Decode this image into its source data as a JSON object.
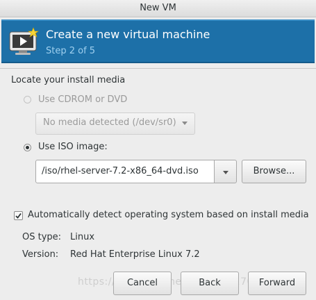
{
  "window": {
    "title": "New VM"
  },
  "banner": {
    "title": "Create a new virtual machine",
    "step": "Step 2 of 5",
    "icon": "vm-monitor-icon",
    "bg_color": "#1d70a8"
  },
  "media": {
    "section_label": "Locate your install media",
    "cdrom_label": "Use CDROM or DVD",
    "cdrom_selected": false,
    "cdrom_enabled": false,
    "cdrom_combo_value": "No media detected (/dev/sr0)",
    "iso_label": "Use ISO image:",
    "iso_selected": true,
    "iso_path": "/iso/rhel-server-7.2-x86_64-dvd.iso",
    "browse_label": "Browse..."
  },
  "detect": {
    "checked": true,
    "label": "Automatically detect operating system based on install media"
  },
  "os": {
    "type_label": "OS type:",
    "type_value": "Linux",
    "version_label": "Version:",
    "version_value": "Red Hat Enterprise Linux 7.2"
  },
  "footer": {
    "cancel_label": "Cancel",
    "back_label": "Back",
    "forward_label": "Forward"
  },
  "watermark": {
    "text": "https://blog.csdn.net/qq_36361707"
  }
}
